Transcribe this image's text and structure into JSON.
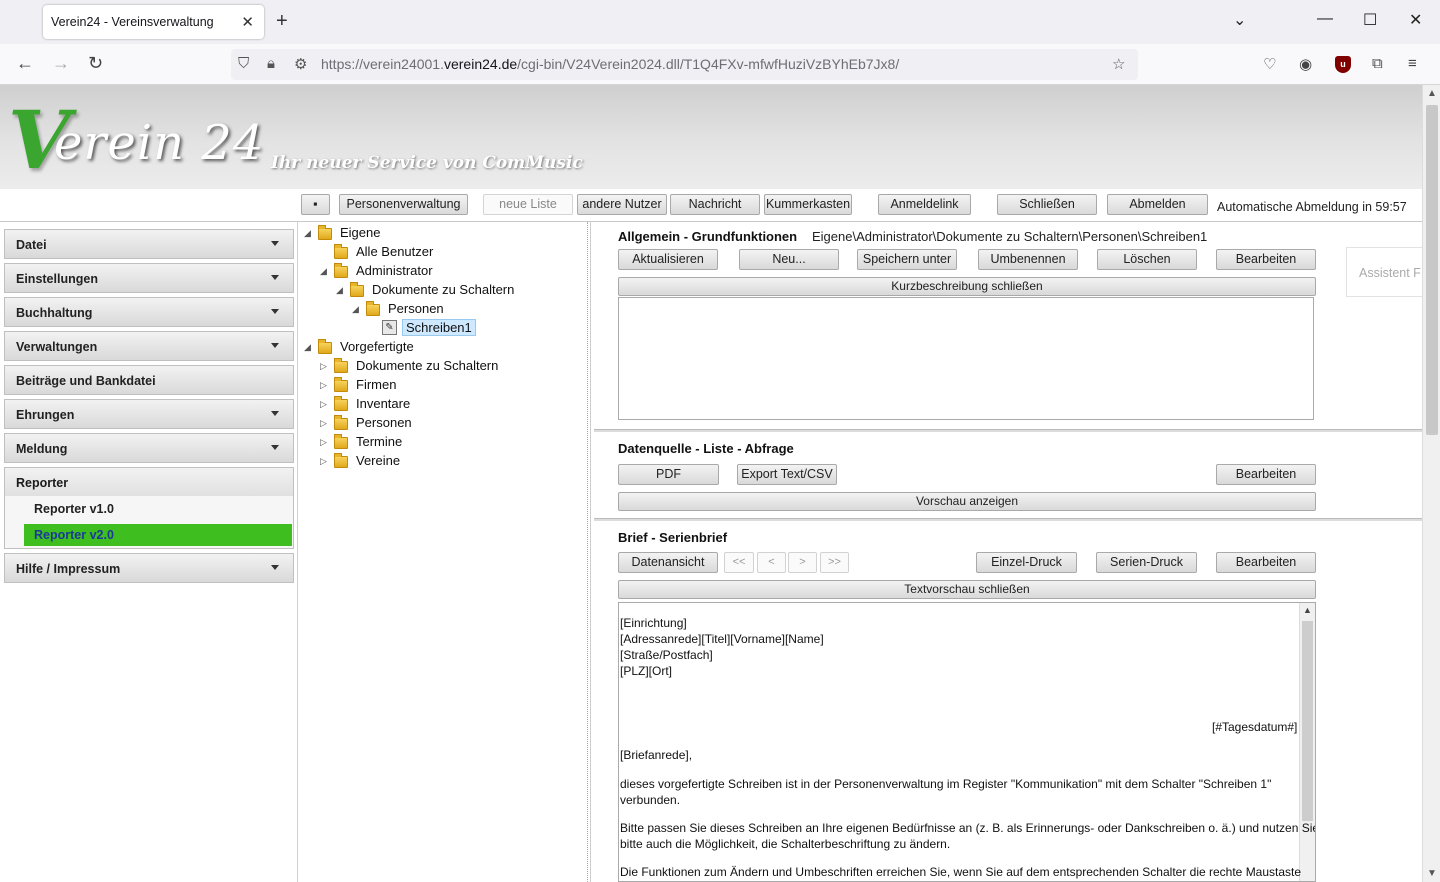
{
  "browser": {
    "tab_title": "Verein24 - Vereinsverwaltung",
    "url_prefix": "https://verein24001.",
    "url_domain": "verein24.de",
    "url_path": "/cgi-bin/V24Verein2024.dll/T1Q4FXv-mfwfHuziVzBYhEb7Jx8/"
  },
  "header": {
    "logo_v": "V",
    "logo_rest": "erein 24",
    "slogan": "Ihr neuer Service von ComMusic"
  },
  "toolbar": {
    "personen": "Personenverwaltung",
    "neue_liste": "neue Liste",
    "andere_nutzer": "andere Nutzer",
    "nachricht": "Nachricht",
    "kummerkasten": "Kummerkasten",
    "anmeldelink": "Anmeldelink",
    "schliessen": "Schließen",
    "abmelden": "Abmelden",
    "auto_logout": "Automatische Abmeldung in 59:57"
  },
  "menu": {
    "datei": "Datei",
    "einstellungen": "Einstellungen",
    "buchhaltung": "Buchhaltung",
    "verwaltungen": "Verwaltungen",
    "beitraege": "Beiträge und Bankdatei",
    "ehrungen": "Ehrungen",
    "meldung": "Meldung",
    "reporter": "Reporter",
    "reporter_v1": "Reporter v1.0",
    "reporter_v2": "Reporter v2.0",
    "hilfe": "Hilfe / Impressum"
  },
  "tree": {
    "eigene": "Eigene",
    "alle_benutzer": "Alle Benutzer",
    "administrator": "Administrator",
    "dok_schalter": "Dokumente zu Schaltern",
    "personen": "Personen",
    "schreiben1": "Schreiben1",
    "vorgefertigte": "Vorgefertigte",
    "v_dok_schalter": "Dokumente zu Schaltern",
    "firmen": "Firmen",
    "inventare": "Inventare",
    "v_personen": "Personen",
    "termine": "Termine",
    "vereine": "Vereine"
  },
  "allgemein": {
    "title": "Allgemein - Grundfunktionen",
    "path": "Eigene\\Administrator\\Dokumente zu Schaltern\\Personen\\Schreiben1",
    "aktualisieren": "Aktualisieren",
    "neu": "Neu...",
    "speichern_unter": "Speichern unter",
    "umbenennen": "Umbenennen",
    "loeschen": "Löschen",
    "bearbeiten": "Bearbeiten",
    "kurzbeschreibung": "Kurzbeschreibung schließen",
    "assistent": "Assistent F"
  },
  "datenquelle": {
    "title": "Datenquelle - Liste - Abfrage",
    "pdf": "PDF",
    "export": "Export Text/CSV",
    "bearbeiten": "Bearbeiten",
    "vorschau": "Vorschau anzeigen"
  },
  "brief": {
    "title": "Brief - Serienbrief",
    "datenansicht": "Datenansicht",
    "first": "<<",
    "prev": "<",
    "next": ">",
    "last": ">>",
    "einzel": "Einzel-Druck",
    "serien": "Serien-Druck",
    "bearbeiten": "Bearbeiten",
    "textvorschau": "Textvorschau schließen",
    "line1": "[Einrichtung]",
    "line2": "[Adressanrede][Titel][Vorname][Name]",
    "line3": "[Straße/Postfach]",
    "line4": "[PLZ][Ort]",
    "date": "[#Tagesdatum#]",
    "salutation": "[Briefanrede],",
    "p1a": "dieses vorgefertigte Schreiben ist in der Personenverwaltung im Register \"Kommunikation\" mit dem Schalter \"Schreiben 1\"",
    "p1b": "verbunden.",
    "p2a": "Bitte passen Sie dieses Schreiben an Ihre eigenen Bedürfnisse an (z. B. als Erinnerungs- oder Dankschreiben o. ä.) und nutzen Sie",
    "p2b": "bitte auch die Möglichkeit, die Schalterbeschriftung zu ändern.",
    "p3a": "Die Funktionen zum Ändern und Umbeschriften erreichen Sie, wenn Sie auf dem entsprechenden Schalter die rechte Maustaste"
  },
  "colors": {
    "accent_green": "#3fbf1f",
    "logo_green": "#3aa52f"
  }
}
